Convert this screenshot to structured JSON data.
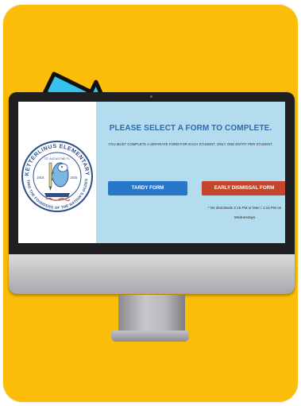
{
  "screen": {
    "title": "PLEASE SELECT A FORM TO COMPLETE.",
    "subtitle": "YOU MUST COMPLETE A SEPARATE FORM FOR EACH STUDENT. ONLY ONE ENTRY PER STUDENT.",
    "buttons": {
      "tardy": "TARDY FORM",
      "early": "EARLY DISMISSAL FORM"
    },
    "note_line1": "* No dismissals 2:15 PM or later / 1:15 PM on",
    "note_line2": "Wednesdays"
  },
  "logo": {
    "top_text": "KETTERLINUS ELEMENTARY",
    "bottom_text": "EDUCATING THE FOUNDERS OF THE NATION'S OLDEST CITY",
    "small_text": "ST. AUGUSTINE FL",
    "year_left": "1918",
    "year_right": "1925"
  },
  "colors": {
    "background_card": "#fbbd08",
    "screen_bg": "#b3dcef",
    "title_color": "#2b6cb0",
    "tardy_button": "#2977c8",
    "early_button": "#c4452a",
    "arrow": "#35c3ec"
  },
  "icons": {
    "arrow": "pointing-arrow-icon",
    "logo": "school-seal-logo"
  }
}
